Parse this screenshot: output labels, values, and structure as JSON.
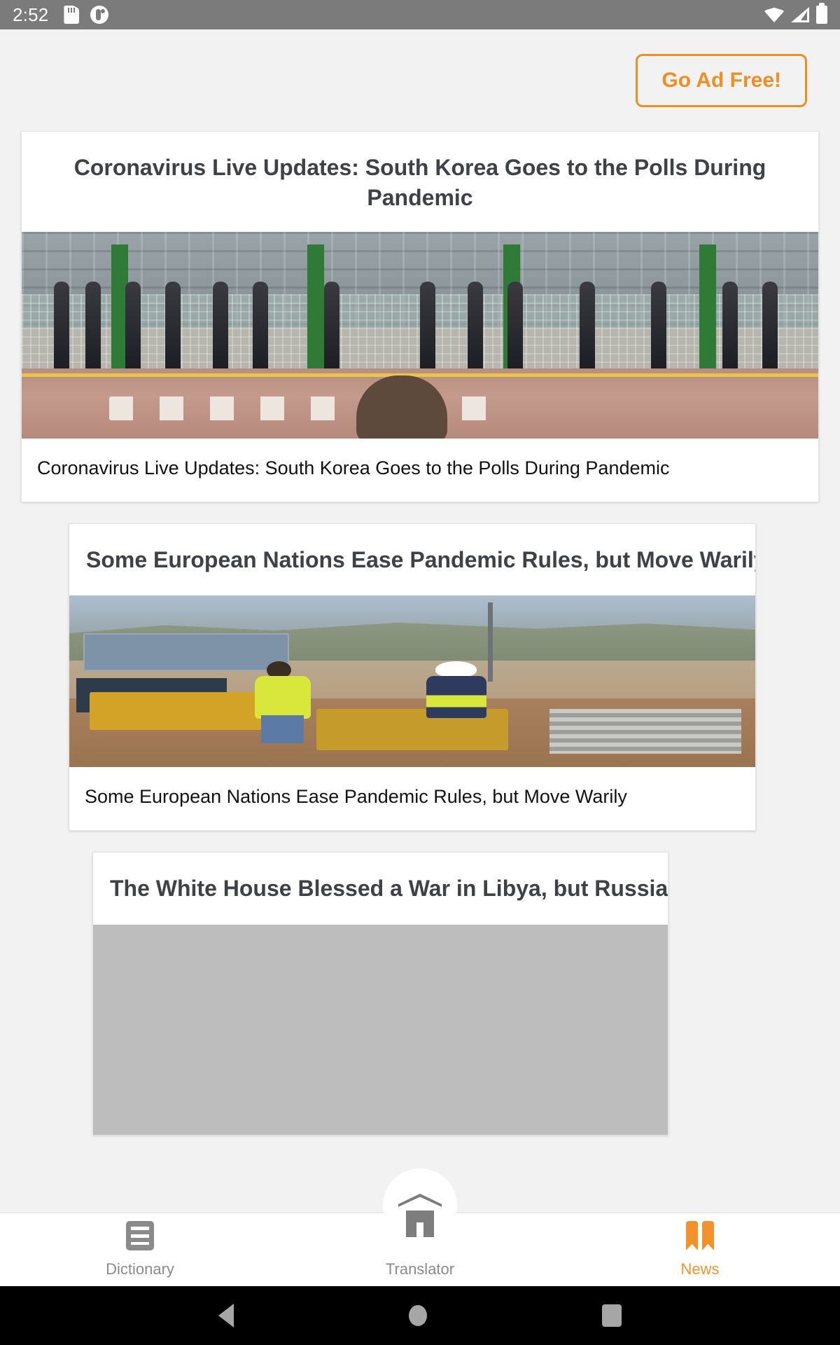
{
  "status_bar": {
    "time": "2:52",
    "left_icons": [
      "sd-card-icon",
      "app-badge-icon"
    ],
    "right_icons": [
      "wifi-icon",
      "cell-signal-icon",
      "battery-icon"
    ]
  },
  "header": {
    "go_ad_free_label": "Go Ad Free!",
    "accent_color": "#ef8f23"
  },
  "feed": {
    "cards": [
      {
        "title": "Coronavirus Live Updates: South Korea Goes to the Polls During Pandemic",
        "caption": "Coronavirus Live Updates: South Korea Goes to the Polls During Pandemic",
        "image_alt": "voters-queue-south-korea-photo"
      },
      {
        "title": "Some European Nations Ease Pandemic Rules, but Move Warily",
        "caption": "Some European Nations Ease Pandemic Rules, but Move Warily",
        "image_alt": "construction-workers-spain-photo"
      },
      {
        "title": "The White House Blessed a War in Libya, but Russia Won It",
        "caption": "",
        "image_alt": "placeholder-image"
      }
    ]
  },
  "bottom_nav": {
    "items": [
      {
        "label": "Dictionary",
        "icon": "list-icon",
        "active": false
      },
      {
        "label": "Translator",
        "icon": "home-icon",
        "active": false
      },
      {
        "label": "News",
        "icon": "book-icon",
        "active": true
      }
    ],
    "active_color": "#f1922d",
    "inactive_color": "#8b8b8b"
  },
  "system_nav": {
    "buttons": [
      "back-button",
      "home-button",
      "recents-button"
    ]
  }
}
